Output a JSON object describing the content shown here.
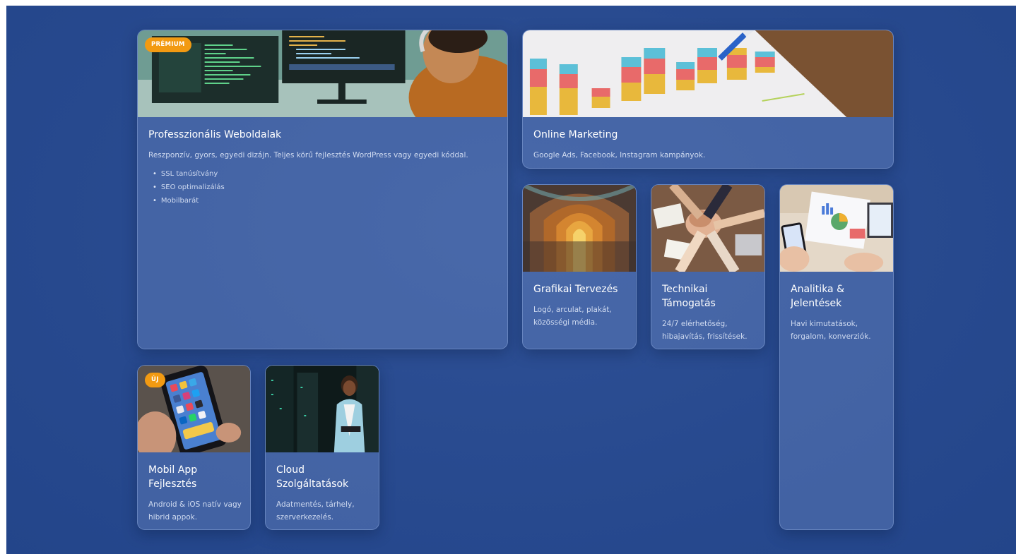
{
  "services": {
    "web": {
      "badge": "PRÉMIUM",
      "title": "Professzionális Weboldalak",
      "desc": "Reszponzív, gyors, egyedi dizájn. Teljes körű fejlesztés WordPress vagy egyedi kóddal.",
      "features": [
        "SSL tanúsítvány",
        "SEO optimalizálás",
        "Mobilbarát"
      ]
    },
    "marketing": {
      "title": "Online Marketing",
      "desc": "Google Ads, Facebook, Instagram kampányok."
    },
    "design": {
      "title": "Grafikai Tervezés",
      "desc": "Logó, arculat, plakát, közösségi média."
    },
    "support": {
      "title": "Technikai Támogatás",
      "desc": "24/7 elérhetőség, hibajavítás, frissítések."
    },
    "analytics": {
      "title": "Analitika & Jelentések",
      "desc": "Havi kimutatások, forgalom, konverziók."
    },
    "mobile": {
      "badge": "ÚJ",
      "title": "Mobil App Fejlesztés",
      "desc": "Android & iOS natív vagy hibrid appok."
    },
    "cloud": {
      "title": "Cloud Szolgáltatások",
      "desc": "Adatmentés, tárhely, szerverkezelés."
    }
  },
  "colors": {
    "background": "#284a8f",
    "badge": "#f29a12",
    "card_title": "#ffffff",
    "card_text": "#cfdaf0"
  },
  "icons": {
    "web": "developer-monitors-photo",
    "marketing": "bar-chart-paper-photo",
    "design": "arched-corridor-photo",
    "support": "team-hands-photo",
    "analytics": "analytics-reports-photo",
    "mobile": "smartphone-apps-photo",
    "cloud": "server-room-photo"
  }
}
